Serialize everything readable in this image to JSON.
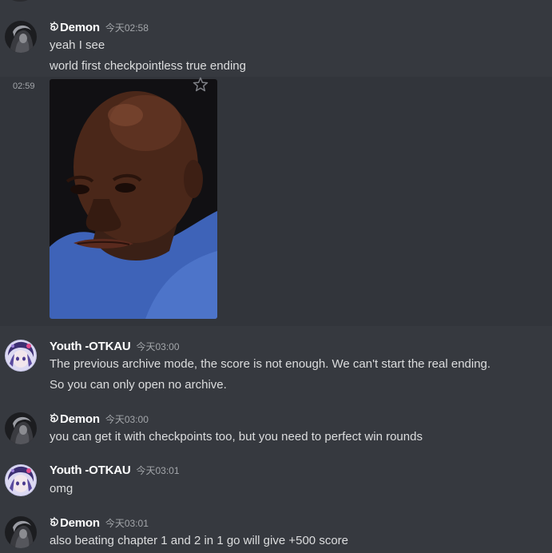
{
  "messages": {
    "m1": {
      "author": "Demon",
      "time": "今天02:58",
      "lines": [
        "yeah I see",
        "world first checkpointless true ending"
      ]
    },
    "m2": {
      "side_time": "02:59",
      "image_alt": "bald man reaction image"
    },
    "m3": {
      "author": "Youth -OTKAU",
      "time": "今天03:00",
      "lines": [
        "The previous archive mode, the score is not enough. We can't start the real ending.",
        "So you can only open no archive."
      ]
    },
    "m4": {
      "author": "Demon",
      "time": "今天03:00",
      "lines": [
        "you can get it with checkpoints too, but you need to perfect win rounds"
      ]
    },
    "m5": {
      "author": "Youth -OTKAU",
      "time": "今天03:01",
      "lines": [
        "omg"
      ]
    },
    "m6": {
      "author": "Demon",
      "time": "今天03:01",
      "lines": [
        "also beating chapter 1 and 2 in 1 go will give +500 score"
      ]
    }
  },
  "icons": {
    "star": "star-icon",
    "author_prefix": "demon-prefix-icon"
  },
  "colors": {
    "background": "#36393f",
    "hover_background": "#32353b",
    "author": "#ffffff",
    "text": "#dcddde",
    "timestamp": "#a3a6aa"
  }
}
